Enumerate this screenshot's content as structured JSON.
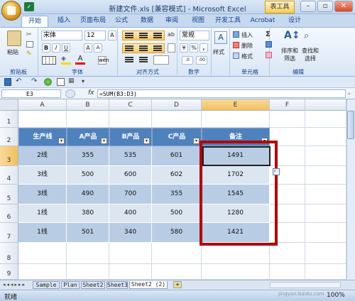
{
  "window": {
    "title": "新建文件.xls [兼容模式] - Microsoft Excel",
    "context_tab": "表工具",
    "buttons": {
      "minimize": "–",
      "restore": "▫",
      "close": "✕"
    }
  },
  "ribbon": {
    "tabs": [
      "开始",
      "插入",
      "页面布局",
      "公式",
      "数据",
      "审阅",
      "视图",
      "开发工具",
      "Acrobat",
      "设计"
    ],
    "active_tab": "开始",
    "font_name": "宋体",
    "font_size": "12",
    "number_format": "常规",
    "groups": {
      "clipboard": "剪贴板",
      "font": "字体",
      "alignment": "对齐方式",
      "number": "数字",
      "cells": "单元格",
      "editing": "编辑"
    },
    "paste_label": "粘贴",
    "style_label": "样式",
    "insert_label": "插入",
    "delete_label": "删除",
    "format_label": "格式",
    "sort_label": "排序和\n筛选",
    "find_label": "查找和\n选择",
    "sort_label_line1": "排序和",
    "sort_label_line2": "筛选",
    "find_label_line1": "查找和",
    "find_label_line2": "选择",
    "bold": "B",
    "italic": "I",
    "underline": "U",
    "percent": "%",
    "comma": ",",
    "sum_symbol": "Σ"
  },
  "formula_bar": {
    "name_box": "E3",
    "fx": "fx",
    "formula": "=SUM(B3:D3)"
  },
  "grid": {
    "columns": [
      "A",
      "B",
      "C",
      "D",
      "E",
      "F"
    ],
    "rows": [
      "1",
      "2",
      "3",
      "4",
      "5",
      "6",
      "7",
      "8",
      "9"
    ],
    "table_header": [
      "生产线",
      "A产品",
      "B产品",
      "C产品",
      "备注"
    ],
    "table_rows": [
      [
        "2线",
        "355",
        "535",
        "601",
        "1491"
      ],
      [
        "3线",
        "500",
        "600",
        "602",
        "1702"
      ],
      [
        "3线",
        "490",
        "700",
        "355",
        "1545"
      ],
      [
        "1线",
        "380",
        "400",
        "500",
        "1280"
      ],
      [
        "1线",
        "501",
        "340",
        "580",
        "1421"
      ]
    ],
    "highlight_color": "#b00000",
    "header_color": "#4f81bd"
  },
  "sheets": {
    "tabs": [
      "Sample",
      "Plan",
      "Sheet2",
      "Sheet3",
      "Sheet2 (2)"
    ],
    "active": "Sheet2 (2)"
  },
  "status": {
    "mode": "就绪",
    "zoom": "100%",
    "watermark": "jingyan.baidu.com"
  }
}
